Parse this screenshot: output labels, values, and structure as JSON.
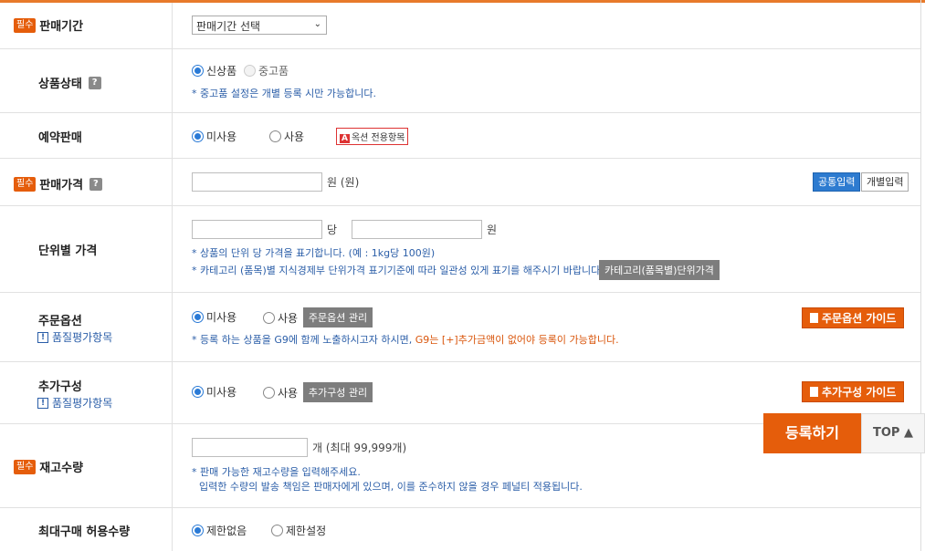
{
  "required_label": "필수",
  "qmark": "?",
  "sale_period": {
    "label": "판매기간",
    "select_value": "판매기간 선택"
  },
  "condition": {
    "label": "상품상태",
    "options": [
      "신상품",
      "중고품"
    ],
    "note": "* 중고품 설정은 개별 등록 시만 가능합니다."
  },
  "reservation": {
    "label": "예약판매",
    "options": [
      "미사용",
      "사용"
    ],
    "badge_icon": "A",
    "badge_text": "옥션 전용항목"
  },
  "price": {
    "label": "판매가격",
    "unit": "원 (원)",
    "toggle_common": "공통입력",
    "toggle_individual": "개별입력"
  },
  "unit_price": {
    "label": "단위별 가격",
    "per": "당",
    "won": "원",
    "note1": "* 상품의 단위 당 가격을 표기합니다. (예 : 1kg당 100원)",
    "note2": "* 카테고리 (품목)별 지식경제부 단위가격 표기기준에 따라 일관성 있게 표기를 해주시기 바랍니다.",
    "button": "카테고리(품목별)단위가격"
  },
  "order_option": {
    "label": "주문옵션",
    "sub": "품질평가항목",
    "options": [
      "미사용",
      "사용"
    ],
    "manage_button": "주문옵션 관리",
    "guide_button": "주문옵션 가이드",
    "note_prefix": "* 등록 하는 상품을 G9에 함께 노출하시고자 하시면, ",
    "note_highlight": "G9는 [+]추가금액이 없어야 등록이 가능합니다."
  },
  "extra": {
    "label": "추가구성",
    "sub": "품질평가항목",
    "options": [
      "미사용",
      "사용"
    ],
    "manage_button": "추가구성 관리",
    "guide_button": "추가구성 가이드"
  },
  "stock": {
    "label": "재고수량",
    "unit": "개 (최대 99,999개)",
    "note1": "* 판매 가능한 재고수량을 입력해주세요.",
    "note2": "입력한 수량의 발송 책임은 판매자에게 있으며, 이를 준수하지 않을 경우 페널티 적용됩니다."
  },
  "max_buy": {
    "label": "최대구매 허용수량",
    "options": [
      "제한없음",
      "제한설정"
    ]
  },
  "floating": {
    "register": "등록하기",
    "top": "TOP ▲"
  },
  "colors": {
    "accent": "#e55d0b",
    "link_blue": "#2b5ea8",
    "radio_blue": "#2a7ad6"
  }
}
